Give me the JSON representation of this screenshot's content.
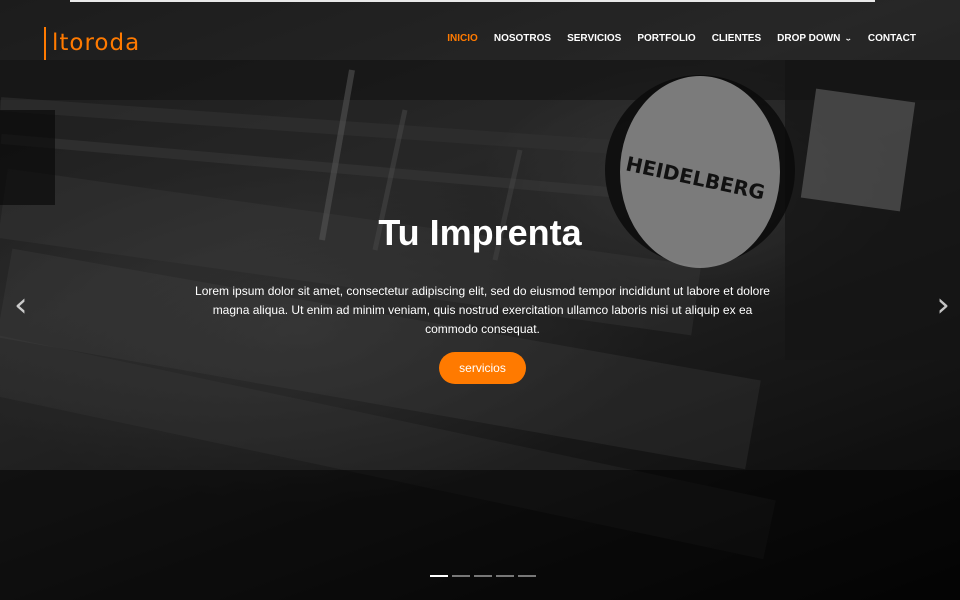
{
  "brand": {
    "logo_text": "ltoroda",
    "accent_color": "#ff7a00"
  },
  "nav": {
    "items": [
      {
        "label": "INICIO",
        "active": true
      },
      {
        "label": "NOSOTROS",
        "active": false
      },
      {
        "label": "SERVICIOS",
        "active": false
      },
      {
        "label": "PORTFOLIO",
        "active": false
      },
      {
        "label": "CLIENTES",
        "active": false
      },
      {
        "label": "DROP DOWN",
        "active": false,
        "has_dropdown": true
      },
      {
        "label": "CONTACT",
        "active": false
      }
    ]
  },
  "hero": {
    "title": "Tu Imprenta",
    "description": "Lorem ipsum dolor sit amet, consectetur adipiscing elit, sed do eiusmod tempor incididunt ut labore et dolore magna aliqua. Ut enim ad minim veniam, quis nostrud exercitation ullamco laboris nisi ut aliquip ex ea commodo consequat.",
    "button_label": "servicios",
    "background_brand_text": "HEIDELBERG"
  },
  "slider": {
    "prev_icon": "‹",
    "next_icon": "›",
    "slide_count": 5,
    "active_index": 0
  }
}
